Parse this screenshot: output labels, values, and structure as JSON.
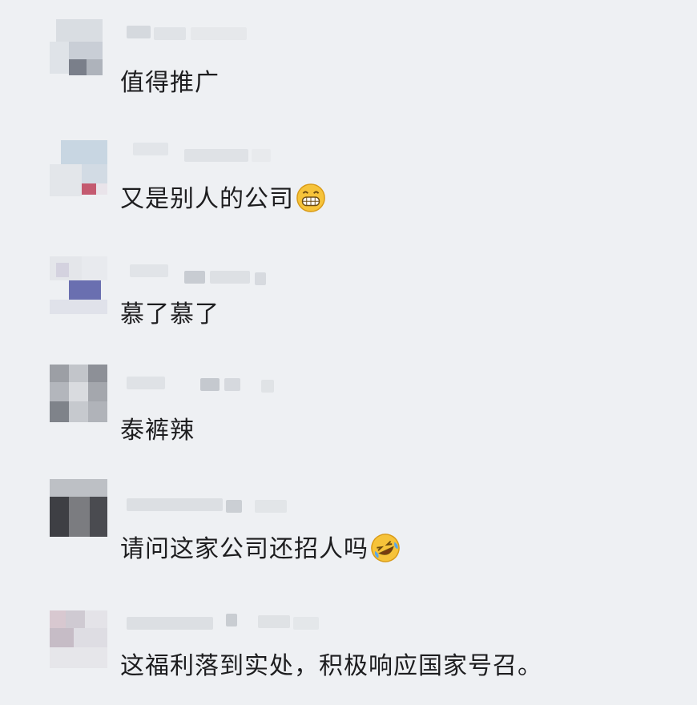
{
  "comments": [
    {
      "text": "值得推广",
      "emoji": ""
    },
    {
      "text": "又是别人的公司",
      "emoji": "grinning-face-icon"
    },
    {
      "text": "慕了慕了",
      "emoji": ""
    },
    {
      "text": "泰裤辣",
      "emoji": ""
    },
    {
      "text": "请问这家公司还招人吗",
      "emoji": "laughing-tears-face-icon"
    },
    {
      "text": "这福利落到实处，积极响应国家号召。",
      "emoji": ""
    }
  ]
}
